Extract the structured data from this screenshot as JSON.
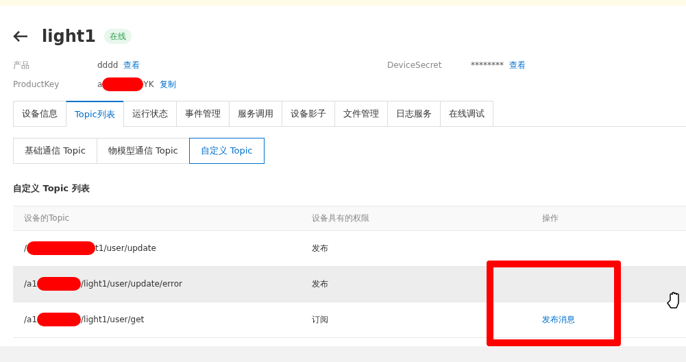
{
  "title": "light1",
  "status": "在线",
  "info": [
    {
      "label": "产品",
      "value": "dddd",
      "action": "查看"
    },
    {
      "label": "ProductKey",
      "prefix": "a",
      "suffix": "YK",
      "action": "复制"
    }
  ],
  "info_right": [
    {
      "label": "DeviceSecret",
      "value": "********",
      "action": "查看"
    }
  ],
  "tabs": [
    {
      "label": "设备信息",
      "selected": false
    },
    {
      "label": "Topic列表",
      "selected": true
    },
    {
      "label": "运行状态",
      "selected": false
    },
    {
      "label": "事件管理",
      "selected": false
    },
    {
      "label": "服务调用",
      "selected": false
    },
    {
      "label": "设备影子",
      "selected": false
    },
    {
      "label": "文件管理",
      "selected": false
    },
    {
      "label": "日志服务",
      "selected": false
    },
    {
      "label": "在线调试",
      "selected": false
    }
  ],
  "subtabs": [
    {
      "label": "基础通信 Topic",
      "selected": false
    },
    {
      "label": "物模型通信 Topic",
      "selected": false
    },
    {
      "label": "自定义 Topic",
      "selected": true
    }
  ],
  "section_title": "自定义 Topic 列表",
  "table": {
    "columns": [
      "设备的Topic",
      "设备具有的权限",
      "操作"
    ],
    "rows": [
      {
        "prefix": "/",
        "suffix": "t1/user/update",
        "permission": "发布",
        "action": null,
        "highlighted": false
      },
      {
        "prefix": "/a1",
        "suffix": "/light1/user/update/error",
        "permission": "发布",
        "action": null,
        "highlighted": true
      },
      {
        "prefix": "/a1",
        "suffix": "/light1/user/get",
        "permission": "订阅",
        "action": "发布消息",
        "highlighted": false
      }
    ]
  }
}
